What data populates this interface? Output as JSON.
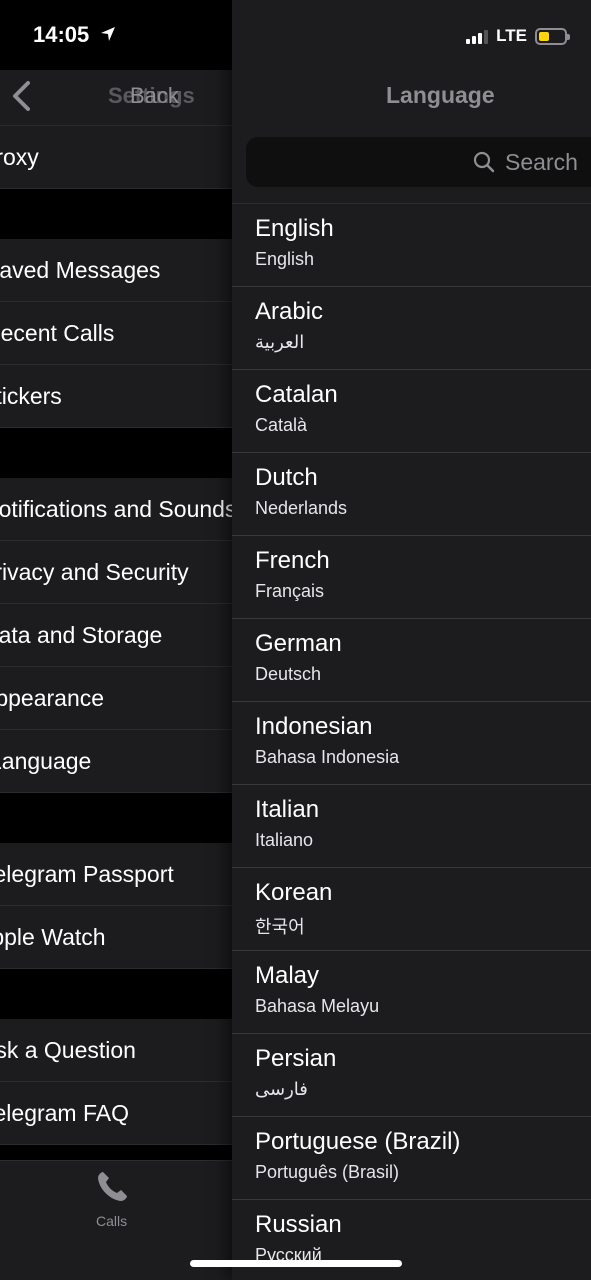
{
  "status_bar": {
    "time": "14:05",
    "network": "LTE",
    "battery_color": "#ffd60a"
  },
  "left_screen": {
    "title": "Settings",
    "back_label": "Back",
    "sections": [
      [
        {
          "label": "Proxy"
        }
      ],
      [
        {
          "label": "Saved Messages"
        },
        {
          "label": "Recent Calls"
        },
        {
          "label": "Stickers"
        }
      ],
      [
        {
          "label": "Notifications and Sounds"
        },
        {
          "label": "Privacy and Security"
        },
        {
          "label": "Data and Storage"
        },
        {
          "label": "Appearance"
        },
        {
          "label": "Language"
        }
      ],
      [
        {
          "label": "Telegram Passport"
        },
        {
          "label": "Apple Watch"
        }
      ],
      [
        {
          "label": "Ask a Question"
        },
        {
          "label": "Telegram FAQ"
        }
      ]
    ],
    "tab_calls_label": "Calls"
  },
  "language_screen": {
    "title": "Language",
    "search_placeholder": "Search",
    "languages": [
      {
        "name": "English",
        "native": "English"
      },
      {
        "name": "Arabic",
        "native": "العربية"
      },
      {
        "name": "Catalan",
        "native": "Català"
      },
      {
        "name": "Dutch",
        "native": "Nederlands"
      },
      {
        "name": "French",
        "native": "Français"
      },
      {
        "name": "German",
        "native": "Deutsch"
      },
      {
        "name": "Indonesian",
        "native": "Bahasa Indonesia"
      },
      {
        "name": "Italian",
        "native": "Italiano"
      },
      {
        "name": "Korean",
        "native": "한국어"
      },
      {
        "name": "Malay",
        "native": "Bahasa Melayu"
      },
      {
        "name": "Persian",
        "native": "فارسی"
      },
      {
        "name": "Portuguese (Brazil)",
        "native": "Português (Brasil)"
      },
      {
        "name": "Russian",
        "native": "Русский"
      }
    ]
  }
}
